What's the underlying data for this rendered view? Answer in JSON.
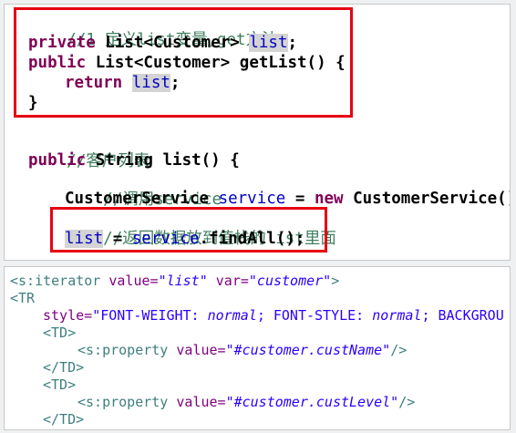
{
  "code_panel": {
    "lines": [
      {
        "comment": "//1 定义list变量,get方法"
      },
      {
        "kw": "private",
        "pre": " List<Customer> ",
        "field": "list",
        "post": ";"
      },
      {
        "kw": "public",
        "text": " List<Customer> getList() {"
      },
      {
        "kw": "return",
        "pre": " ",
        "field": "list",
        "post": ";"
      },
      {
        "text": "}"
      },
      {
        "comment": "//客户列表"
      },
      {
        "kw": "public",
        "text": " String list() {"
      },
      {
        "comment": "//调用service"
      },
      {
        "pre": "CustomerService ",
        "field": "service",
        "mid": " = ",
        "kw": "new",
        "post": " CustomerService();"
      },
      {
        "comment": "//返回数据放到值栈的list里面"
      },
      {
        "field": "list",
        "mid": " = ",
        "field2": "service",
        "post": ".findAll();"
      }
    ]
  },
  "xml_panel": {
    "line1": {
      "tag_open": "<s:iterator",
      "attr1": " value=",
      "val1": "\"list\"",
      "attr2": " var=",
      "val2": "\"customer\"",
      "tag_close": ">"
    },
    "line2": {
      "tag": "<TR"
    },
    "line3": {
      "attr": "style=",
      "text": "\"FONT-WEIGHT: ",
      "val1": "normal",
      "text2": "; FONT-STYLE: ",
      "val2": "normal",
      "text3": "; BACKGROU"
    },
    "line4": {
      "tag": "<TD>"
    },
    "line5": {
      "tag_open": "<s:property",
      "attr": " value=",
      "val": "\"#customer.custName\"",
      "tag_close": "/>"
    },
    "line6": {
      "tag": "</TD>"
    },
    "line7": {
      "tag": "<TD>"
    },
    "line8": {
      "tag_open": "<s:property",
      "attr": " value=",
      "val": "\"#customer.custLevel\"",
      "tag_close": "/>"
    },
    "line9": {
      "tag": "</TD>"
    }
  },
  "colors": {
    "highlight_box": "#e60012",
    "keyword": "#7f0055",
    "comment": "#3f7f5f",
    "field": "#0000c0"
  }
}
